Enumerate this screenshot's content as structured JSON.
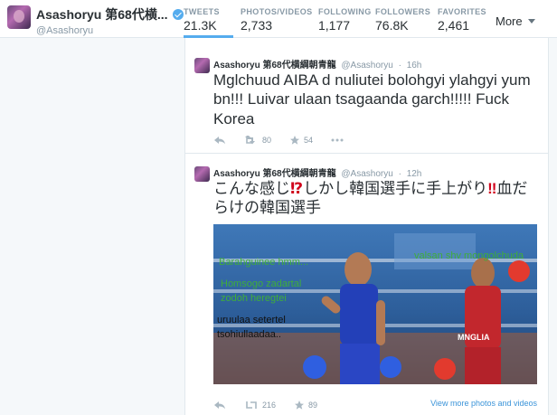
{
  "profile": {
    "name": "Asashoryu 第68代横...",
    "handle": "@Asashoryu"
  },
  "stats": [
    {
      "label": "TWEETS",
      "value": "21.3K"
    },
    {
      "label": "PHOTOS/VIDEOS",
      "value": "2,733"
    },
    {
      "label": "FOLLOWING",
      "value": "1,177"
    },
    {
      "label": "FOLLOWERS",
      "value": "76.8K"
    },
    {
      "label": "FAVORITES",
      "value": "2,461"
    }
  ],
  "more_label": "More",
  "tweets": [
    {
      "name": "Asashoryu 第68代横綱朝青龍",
      "handle": "@Asashoryu",
      "time": "16h",
      "text": "Mglchuud AIBA d nuliutei bolohgyi ylahgyi yum bn!!! Luivar ulaan tsagaanda garch!!!!! Fuck Korea",
      "retweets": "80",
      "favorites": "54"
    },
    {
      "name": "Asashoryu 第68代横綱朝青龍",
      "handle": "@Asashoryu",
      "time": "12h",
      "text_part1": "こんな感じ",
      "text_mark1": "⁉",
      "text_part2": "しかし韓国選手に手上がり",
      "text_mark2": "‼",
      "text_part3": "血だらけの韓国選手",
      "retweets": "216",
      "favorites": "89",
      "view_more": "View more photos and videos",
      "media_overlays": {
        "line1": "Barahguinee hmm...",
        "line2": "Homsogo zadartal",
        "line3": "zodoh heregtei",
        "line4": "uruulaa setertel",
        "line5": "tsohiullaadaa..",
        "right1": "valsan shv mongolchuda"
      },
      "shirt_label": "MNGLIA"
    }
  ],
  "colors": {
    "accent": "#55acee",
    "link": "#3b94d9",
    "overlay_green": "#3fae3a"
  }
}
